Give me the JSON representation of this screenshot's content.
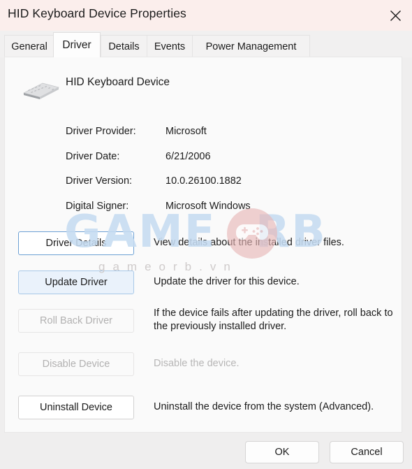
{
  "window": {
    "title": "HID Keyboard Device Properties",
    "close_icon": "close-icon",
    "titlebar_color": "#fbeeec"
  },
  "tabs": [
    {
      "label": "General",
      "active": false
    },
    {
      "label": "Driver",
      "active": true
    },
    {
      "label": "Details",
      "active": false
    },
    {
      "label": "Events",
      "active": false
    },
    {
      "label": "Power Management",
      "active": false
    }
  ],
  "device": {
    "icon": "keyboard-icon",
    "name": "HID Keyboard Device"
  },
  "info_rows": [
    {
      "label": "Driver Provider:",
      "value": "Microsoft"
    },
    {
      "label": "Driver Date:",
      "value": "6/21/2006"
    },
    {
      "label": "Driver Version:",
      "value": "10.0.26100.1882"
    },
    {
      "label": "Digital Signer:",
      "value": "Microsoft Windows"
    }
  ],
  "actions": [
    {
      "name": "driver-details",
      "label": "Driver Details",
      "description": "View details about the installed driver files.",
      "state": "focused"
    },
    {
      "name": "update-driver",
      "label": "Update Driver",
      "description": "Update the driver for this device.",
      "state": "hover"
    },
    {
      "name": "roll-back-driver",
      "label": "Roll Back Driver",
      "description": "If the device fails after updating the driver, roll back to the previously installed driver.",
      "state": "disabled"
    },
    {
      "name": "disable-device",
      "label": "Disable Device",
      "description": "Disable the device.",
      "state": "disabled"
    },
    {
      "name": "uninstall-device",
      "label": "Uninstall Device",
      "description": "Uninstall the device from the system (Advanced).",
      "state": "normal"
    }
  ],
  "footer": {
    "ok_label": "OK",
    "cancel_label": "Cancel"
  },
  "watermark": {
    "word_left": "GAM",
    "word_right": "RB",
    "middle_letter": "E",
    "icon": "gamepad-icon",
    "subtitle": "gameorb.vn",
    "word_color": "#c6dcf2",
    "icon_color": "#e8b6b6"
  }
}
